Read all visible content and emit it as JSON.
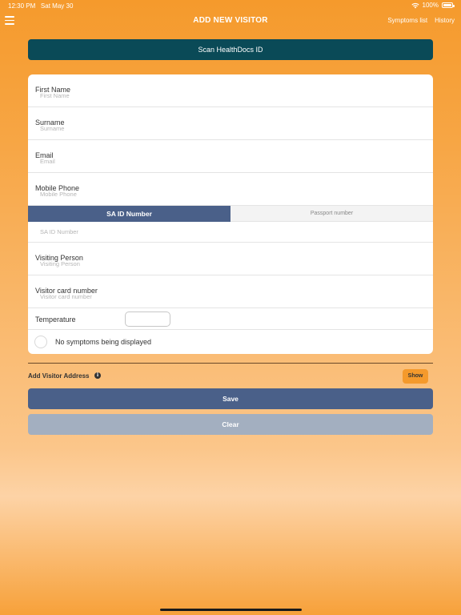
{
  "status_bar": {
    "time": "12:30 PM",
    "date": "Sat May 30",
    "battery": "100%"
  },
  "nav": {
    "title": "ADD NEW VISITOR",
    "symptoms_list": "Symptoms list",
    "history": "History"
  },
  "scan_button": "Scan HealthDocs ID",
  "form": {
    "first_name": {
      "label": "First Name",
      "placeholder": "First Name",
      "value": ""
    },
    "surname": {
      "label": "Surname",
      "placeholder": "Surname",
      "value": ""
    },
    "email": {
      "label": "Email",
      "placeholder": "Email",
      "value": ""
    },
    "mobile_phone": {
      "label": "Mobile Phone",
      "placeholder": "Mobile Phone",
      "value": ""
    },
    "id_tabs": {
      "active": "SA ID Number",
      "inactive": "Passport number"
    },
    "sa_id": {
      "placeholder": "SA ID Number",
      "value": ""
    },
    "visiting_person": {
      "label": "Visiting Person",
      "placeholder": "Visiting Person",
      "value": ""
    },
    "visitor_card": {
      "label": "Visitor card number",
      "placeholder": "Visitor card number",
      "value": ""
    },
    "temperature": {
      "label": "Temperature",
      "value": ""
    },
    "symptoms": {
      "label": "No symptoms being displayed",
      "checked": false
    }
  },
  "address": {
    "label": "Add Visitor Address",
    "show_button": "Show"
  },
  "save_button": "Save",
  "clear_button": "Clear",
  "colors": {
    "brand_orange": "#f59a2c",
    "scan_teal": "#0a4a57",
    "primary_blue": "#4a6089",
    "disabled_gray_blue": "#a3afc0"
  }
}
